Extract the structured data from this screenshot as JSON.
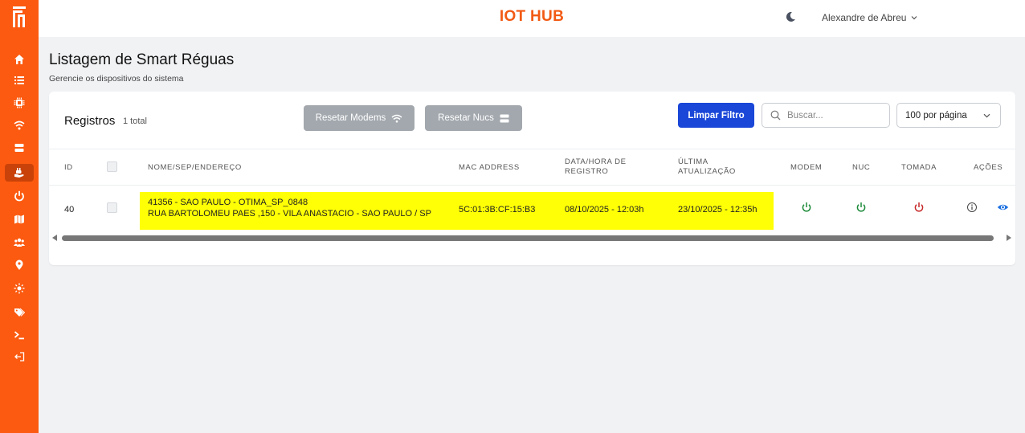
{
  "app": {
    "title": "IOT HUB",
    "user_name": "Alexandre de Abreu"
  },
  "colors": {
    "sidebar": "#fb5a10",
    "title": "#f25a14",
    "primary_button": "#1a47d8",
    "secondary_button": "#a3a8ae",
    "highlight": "#ffff05",
    "power_on": "#1d8a3a",
    "power_off": "#c62828",
    "eye": "#1a6fe0"
  },
  "sidebar": {
    "items": [
      {
        "icon": "home-icon"
      },
      {
        "icon": "list-icon"
      },
      {
        "icon": "chip-icon"
      },
      {
        "icon": "wifi-icon"
      },
      {
        "icon": "server-icon"
      },
      {
        "icon": "plug-hand-icon",
        "active": true
      },
      {
        "icon": "power-icon"
      },
      {
        "icon": "map-icon"
      },
      {
        "icon": "users-icon"
      },
      {
        "icon": "location-pin-icon"
      },
      {
        "icon": "sun-icon"
      },
      {
        "icon": "tags-icon"
      },
      {
        "icon": "terminal-icon"
      },
      {
        "icon": "logout-icon"
      }
    ]
  },
  "page": {
    "title": "Listagem de Smart Réguas",
    "subtitle": "Gerencie os dispositivos do sistema"
  },
  "registros": {
    "title": "Registros",
    "count": "1 total",
    "reset_modems_label": "Resetar Modems",
    "reset_nucs_label": "Resetar Nucs",
    "clear_filter_label": "Limpar Filtro",
    "search_placeholder": "Buscar...",
    "per_page": "100 por página"
  },
  "table": {
    "headers": {
      "id": "ID",
      "name": "NOME/SEP/ENDEREÇO",
      "mac": "MAC ADDRESS",
      "registered_l1": "DATA/HORA DE",
      "registered_l2": "REGISTRO",
      "updated_l1": "ÚLTIMA",
      "updated_l2": "ATUALIZAÇÃO",
      "modem": "MODEM",
      "nuc": "NUC",
      "tomada": "TOMADA",
      "acoes": "AÇÕES"
    },
    "rows": [
      {
        "id": "40",
        "name": "41356 - SAO PAULO - OTIMA_SP_0848",
        "address": "RUA BARTOLOMEU PAES ,150 - VILA ANASTACIO - SAO PAULO / SP",
        "mac": "5C:01:3B:CF:15:B3",
        "registered": "08/10/2025 - 12:03h",
        "updated": "23/10/2025 - 12:35h",
        "modem": "on",
        "nuc": "on",
        "tomada": "off"
      }
    ]
  }
}
